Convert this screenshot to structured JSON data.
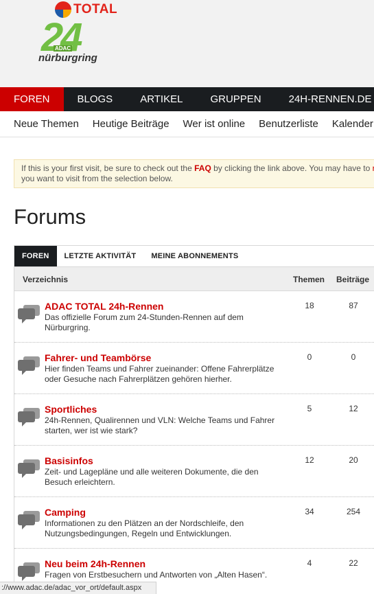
{
  "logo": {
    "brand": "TOTAL",
    "number": "24",
    "badge": "ADAC",
    "place": "nürburgring"
  },
  "main_nav": [
    {
      "label": "FOREN",
      "active": true
    },
    {
      "label": "BLOGS"
    },
    {
      "label": "ARTIKEL"
    },
    {
      "label": "GRUPPEN"
    },
    {
      "label": "24H-RENNEN.DE"
    }
  ],
  "sub_nav": [
    {
      "label": "Neue Themen"
    },
    {
      "label": "Heutige Beiträge"
    },
    {
      "label": "Wer ist online"
    },
    {
      "label": "Benutzerliste"
    },
    {
      "label": "Kalender"
    }
  ],
  "notice": {
    "part1": "If this is your first visit, be sure to check out the ",
    "faq": "FAQ",
    "part2": " by clicking the link above. You may have to ",
    "part2_cut": "r",
    "line2": "you want to visit from the selection below."
  },
  "page_title": "Forums",
  "tabs": [
    {
      "label": "FOREN",
      "active": true
    },
    {
      "label": "LETZTE AKTIVITÄT"
    },
    {
      "label": "MEINE ABONNEMENTS"
    }
  ],
  "table_header": {
    "directory": "Verzeichnis",
    "topics": "Themen",
    "posts": "Beiträge"
  },
  "forums": [
    {
      "title": "ADAC TOTAL 24h-Rennen",
      "description": "Das offizielle Forum zum 24-Stunden-Rennen auf dem Nürburgring.",
      "topics": "18",
      "posts": "87"
    },
    {
      "title": "Fahrer- und Teambörse",
      "description": "Hier finden Teams und Fahrer zueinander: Offene Fahrerplätze oder Gesuche nach Fahrerplätzen gehören hierher.",
      "topics": "0",
      "posts": "0"
    },
    {
      "title": "Sportliches",
      "description": "24h-Rennen, Qualirennen und VLN: Welche Teams und Fahrer starten, wer ist wie stark?",
      "topics": "5",
      "posts": "12"
    },
    {
      "title": "Basisinfos",
      "description": "Zeit- und Lagepläne und alle weiteren Dokumente, die den Besuch erleichtern.",
      "topics": "12",
      "posts": "20"
    },
    {
      "title": "Camping",
      "description": "Informationen zu den Plätzen an der Nordschleife, den Nutzungsbedingungen, Regeln und Entwicklungen.",
      "topics": "34",
      "posts": "254"
    },
    {
      "title": "Neu beim 24h-Rennen",
      "description": "Fragen von Erstbesuchern und Antworten von „Alten Hasen“.",
      "topics": "4",
      "posts": "22"
    }
  ],
  "status_bar": "://www.adac.de/adac_vor_ort/default.aspx",
  "colors": {
    "accent": "#cc0000",
    "nav_dark": "#1a1d20",
    "logo_green": "#72bf44"
  },
  "icons": {
    "forum_row": "speech-bubbles-icon"
  }
}
